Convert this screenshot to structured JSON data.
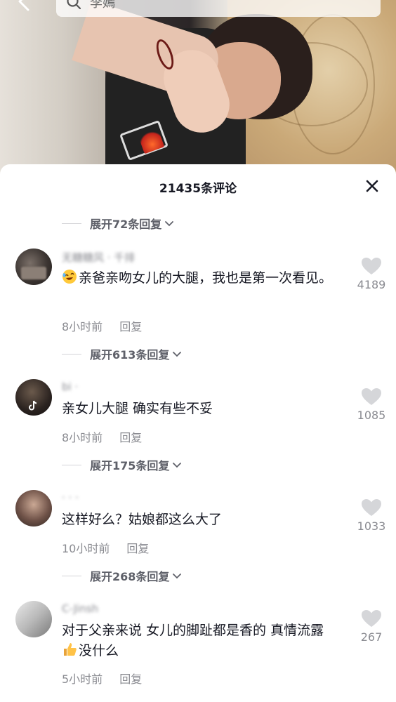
{
  "search": {
    "placeholder": "李嫣"
  },
  "sheet": {
    "title": "21435条评论"
  },
  "expanders": [
    {
      "label": "展开72条回复"
    },
    {
      "label": "展开613条回复"
    },
    {
      "label": "展开175条回复"
    },
    {
      "label": "展开268条回复"
    }
  ],
  "comments": [
    {
      "username": "无糖糖风 · 千排",
      "text": "亲爸亲吻女儿的大腿，我也是第一次看见。",
      "emoji_before": "rolling-laugh",
      "time": "8小时前",
      "reply": "回复",
      "likes": "4189"
    },
    {
      "username": "bi ·",
      "text": "亲女儿大腿 确实有些不妥",
      "time": "8小时前",
      "reply": "回复",
      "likes": "1085"
    },
    {
      "username": "· · ·",
      "text": "这样好么？姑娘都这么大了",
      "time": "10小时前",
      "reply": "回复",
      "likes": "1033"
    },
    {
      "username": "C-Jinsh",
      "text_part1": "对于父亲来说 女儿的脚趾都是香的 真情流露",
      "emoji_mid": "thumbs-up",
      "text_part2": "没什么",
      "time": "5小时前",
      "reply": "回复",
      "likes": "267"
    }
  ],
  "colors": {
    "text_primary": "#161823",
    "text_secondary": "#8a8b91",
    "accent_dim": "#5e6069"
  },
  "icons": {
    "back": "back-chevron-icon",
    "search": "search-icon",
    "close": "close-icon",
    "like": "heart-icon",
    "expand": "chevron-down-icon"
  }
}
